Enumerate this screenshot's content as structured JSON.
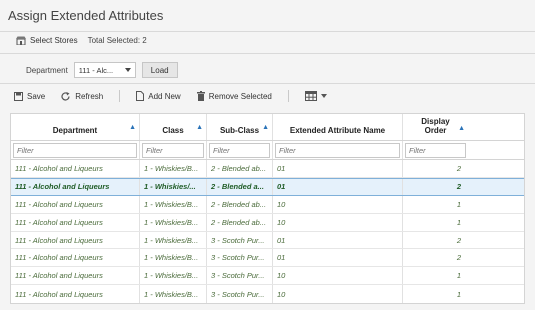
{
  "title": "Assign Extended Attributes",
  "bar": {
    "select_stores": "Select Stores",
    "total_selected": "Total Selected: 2"
  },
  "filters": {
    "department_label": "Department",
    "department_value": "111 - Alc...",
    "load_label": "Load"
  },
  "toolbar": {
    "save": "Save",
    "refresh": "Refresh",
    "add_new": "Add New",
    "remove_selected": "Remove Selected"
  },
  "table": {
    "headers": {
      "department": "Department",
      "class": "Class",
      "subclass": "Sub-Class",
      "attr": "Extended Attribute Name",
      "order1": "Display",
      "order2": "Order"
    },
    "filter_placeholder": "Filter",
    "rows": [
      {
        "department": "111 - Alcohol and Liqueurs",
        "class": "1 - Whiskies/B...",
        "subclass": "2 - Blended ab...",
        "attr": "01",
        "order": "2"
      },
      {
        "department": "111 - Alcohol and Liqueurs",
        "class": "1 - Whiskies/...",
        "subclass": "2 - Blended a...",
        "attr": "01",
        "order": "2"
      },
      {
        "department": "111 - Alcohol and Liqueurs",
        "class": "1 - Whiskies/B...",
        "subclass": "2 - Blended ab...",
        "attr": "10",
        "order": "1"
      },
      {
        "department": "111 - Alcohol and Liqueurs",
        "class": "1 - Whiskies/B...",
        "subclass": "2 - Blended ab...",
        "attr": "10",
        "order": "1"
      },
      {
        "department": "111 - Alcohol and Liqueurs",
        "class": "1 - Whiskies/B...",
        "subclass": "3 - Scotch Pur...",
        "attr": "01",
        "order": "2"
      },
      {
        "department": "111 - Alcohol and Liqueurs",
        "class": "1 - Whiskies/B...",
        "subclass": "3 - Scotch Pur...",
        "attr": "01",
        "order": "2"
      },
      {
        "department": "111 - Alcohol and Liqueurs",
        "class": "1 - Whiskies/B...",
        "subclass": "3 - Scotch Pur...",
        "attr": "10",
        "order": "1"
      },
      {
        "department": "111 - Alcohol and Liqueurs",
        "class": "1 - Whiskies/B...",
        "subclass": "3 - Scotch Pur...",
        "attr": "10",
        "order": "1"
      }
    ]
  },
  "colors": {
    "accent": "#2a73b8",
    "selected_row": "#e5f1fb"
  }
}
